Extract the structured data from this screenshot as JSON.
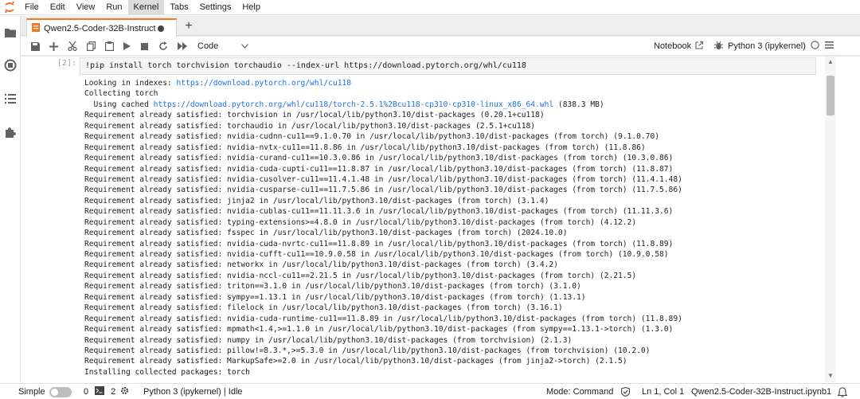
{
  "menubar": {
    "items": [
      "File",
      "Edit",
      "View",
      "Run",
      "Kernel",
      "Tabs",
      "Settings",
      "Help"
    ],
    "active": "Kernel"
  },
  "tab": {
    "label": "Qwen2.5-Coder-32B-Instruct",
    "new_tab": "+"
  },
  "toolbar": {
    "cell_type": "Code",
    "notebook_label": "Notebook",
    "kernel_name": "Python 3 (ipykernel)"
  },
  "cell": {
    "prompt": "[2]:",
    "code": "!pip install torch torchvision torchaudio --index-url https://download.pytorch.org/whl/cu118"
  },
  "output": [
    {
      "text": "Looking in indexes: ",
      "link": "https://download.pytorch.org/whl/cu118",
      "after": ""
    },
    {
      "text": "Collecting torch",
      "link": "",
      "after": ""
    },
    {
      "text": "  Using cached ",
      "link": "https://download.pytorch.org/whl/cu118/torch-2.5.1%2Bcu118-cp310-cp310-linux_x86_64.whl",
      "after": " (838.3 MB)"
    },
    {
      "text": "Requirement already satisfied: torchvision in /usr/local/lib/python3.10/dist-packages (0.20.1+cu118)",
      "link": "",
      "after": ""
    },
    {
      "text": "Requirement already satisfied: torchaudio in /usr/local/lib/python3.10/dist-packages (2.5.1+cu118)",
      "link": "",
      "after": ""
    },
    {
      "text": "Requirement already satisfied: nvidia-cudnn-cu11==9.1.0.70 in /usr/local/lib/python3.10/dist-packages (from torch) (9.1.0.70)",
      "link": "",
      "after": ""
    },
    {
      "text": "Requirement already satisfied: nvidia-nvtx-cu11==11.8.86 in /usr/local/lib/python3.10/dist-packages (from torch) (11.8.86)",
      "link": "",
      "after": ""
    },
    {
      "text": "Requirement already satisfied: nvidia-curand-cu11==10.3.0.86 in /usr/local/lib/python3.10/dist-packages (from torch) (10.3.0.86)",
      "link": "",
      "after": ""
    },
    {
      "text": "Requirement already satisfied: nvidia-cuda-cupti-cu11==11.8.87 in /usr/local/lib/python3.10/dist-packages (from torch) (11.8.87)",
      "link": "",
      "after": ""
    },
    {
      "text": "Requirement already satisfied: nvidia-cusolver-cu11==11.4.1.48 in /usr/local/lib/python3.10/dist-packages (from torch) (11.4.1.48)",
      "link": "",
      "after": ""
    },
    {
      "text": "Requirement already satisfied: nvidia-cusparse-cu11==11.7.5.86 in /usr/local/lib/python3.10/dist-packages (from torch) (11.7.5.86)",
      "link": "",
      "after": ""
    },
    {
      "text": "Requirement already satisfied: jinja2 in /usr/local/lib/python3.10/dist-packages (from torch) (3.1.4)",
      "link": "",
      "after": ""
    },
    {
      "text": "Requirement already satisfied: nvidia-cublas-cu11==11.11.3.6 in /usr/local/lib/python3.10/dist-packages (from torch) (11.11.3.6)",
      "link": "",
      "after": ""
    },
    {
      "text": "Requirement already satisfied: typing-extensions>=4.8.0 in /usr/local/lib/python3.10/dist-packages (from torch) (4.12.2)",
      "link": "",
      "after": ""
    },
    {
      "text": "Requirement already satisfied: fsspec in /usr/local/lib/python3.10/dist-packages (from torch) (2024.10.0)",
      "link": "",
      "after": ""
    },
    {
      "text": "Requirement already satisfied: nvidia-cuda-nvrtc-cu11==11.8.89 in /usr/local/lib/python3.10/dist-packages (from torch) (11.8.89)",
      "link": "",
      "after": ""
    },
    {
      "text": "Requirement already satisfied: nvidia-cufft-cu11==10.9.0.58 in /usr/local/lib/python3.10/dist-packages (from torch) (10.9.0.58)",
      "link": "",
      "after": ""
    },
    {
      "text": "Requirement already satisfied: networkx in /usr/local/lib/python3.10/dist-packages (from torch) (3.4.2)",
      "link": "",
      "after": ""
    },
    {
      "text": "Requirement already satisfied: nvidia-nccl-cu11==2.21.5 in /usr/local/lib/python3.10/dist-packages (from torch) (2.21.5)",
      "link": "",
      "after": ""
    },
    {
      "text": "Requirement already satisfied: triton==3.1.0 in /usr/local/lib/python3.10/dist-packages (from torch) (3.1.0)",
      "link": "",
      "after": ""
    },
    {
      "text": "Requirement already satisfied: sympy==1.13.1 in /usr/local/lib/python3.10/dist-packages (from torch) (1.13.1)",
      "link": "",
      "after": ""
    },
    {
      "text": "Requirement already satisfied: filelock in /usr/local/lib/python3.10/dist-packages (from torch) (3.16.1)",
      "link": "",
      "after": ""
    },
    {
      "text": "Requirement already satisfied: nvidia-cuda-runtime-cu11==11.8.89 in /usr/local/lib/python3.10/dist-packages (from torch) (11.8.89)",
      "link": "",
      "after": ""
    },
    {
      "text": "Requirement already satisfied: mpmath<1.4,>=1.1.0 in /usr/local/lib/python3.10/dist-packages (from sympy==1.13.1->torch) (1.3.0)",
      "link": "",
      "after": ""
    },
    {
      "text": "Requirement already satisfied: numpy in /usr/local/lib/python3.10/dist-packages (from torchvision) (2.1.3)",
      "link": "",
      "after": ""
    },
    {
      "text": "Requirement already satisfied: pillow!=8.3.*,>=5.3.0 in /usr/local/lib/python3.10/dist-packages (from torchvision) (10.2.0)",
      "link": "",
      "after": ""
    },
    {
      "text": "Requirement already satisfied: MarkupSafe>=2.0 in /usr/local/lib/python3.10/dist-packages (from jinja2->torch) (2.1.5)",
      "link": "",
      "after": ""
    },
    {
      "text": "Installing collected packages: torch",
      "link": "",
      "after": ""
    }
  ],
  "statusbar": {
    "simple_label": "Simple",
    "terminals_count": "0",
    "kernels_count": "2",
    "kernel_status": "Python 3 (ipykernel) | Idle",
    "mode": "Mode: Command",
    "cursor": "Ln 1, Col 1",
    "filename": "Qwen2.5-Coder-32B-Instruct.ipynb",
    "notifications": "1"
  },
  "colors": {
    "accent": "#f37726",
    "link": "#1a73e8"
  }
}
